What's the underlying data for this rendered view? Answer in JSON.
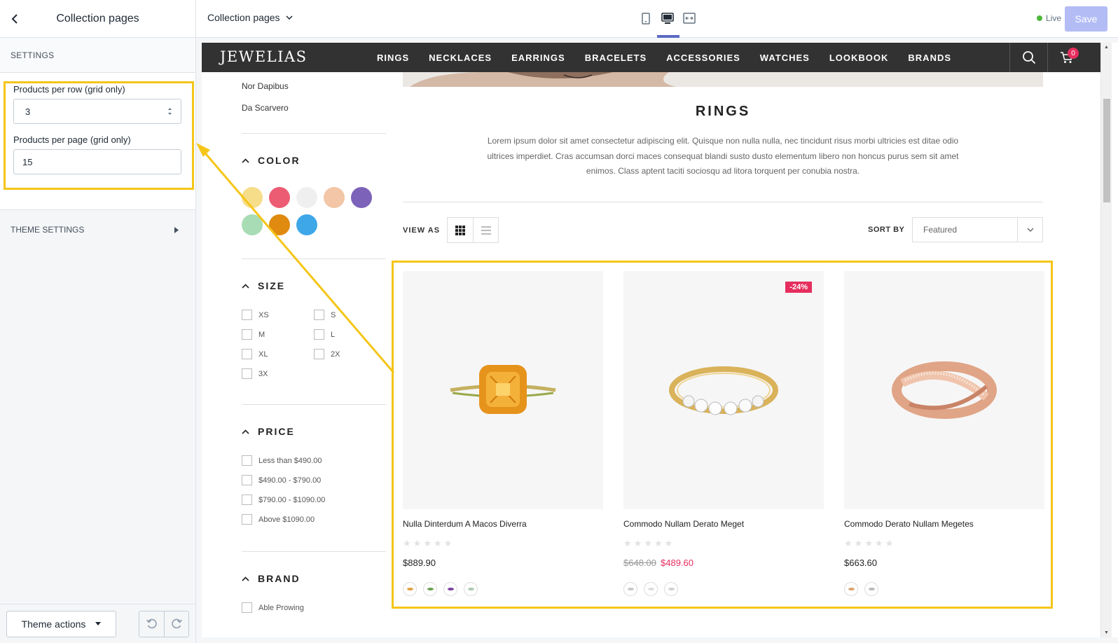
{
  "sidebar": {
    "title": "Collection pages",
    "section_label": "SETTINGS",
    "products_per_row_label": "Products per row (grid only)",
    "products_per_row_value": "3",
    "products_per_page_label": "Products per page (grid only)",
    "products_per_page_value": "15",
    "theme_settings_label": "THEME SETTINGS",
    "theme_actions_label": "Theme actions"
  },
  "topbar": {
    "page_select": "Collection pages",
    "live_label": "Live",
    "save_label": "Save",
    "active_device": "desktop"
  },
  "store": {
    "logo": "JEWELIAS",
    "menu": [
      "RINGS",
      "NECKLACES",
      "EARRINGS",
      "BRACELETS",
      "ACCESSORIES",
      "WATCHES",
      "LOOKBOOK",
      "BRANDS"
    ],
    "cart_count": "0"
  },
  "filters": {
    "vendors": [
      "Nor Dapibus",
      "Da Scarvero"
    ],
    "color_title": "COLOR",
    "colors": [
      "#f6dd8a",
      "#ec5c73",
      "#efefef",
      "#f2c6a6",
      "#7d62b9",
      "#a8dcb4",
      "#e08a10",
      "#3ea7e8"
    ],
    "size_title": "SIZE",
    "sizes": [
      "XS",
      "S",
      "M",
      "L",
      "XL",
      "2X",
      "3X"
    ],
    "price_title": "PRICE",
    "prices": [
      "Less than $490.00",
      "$490.00 - $790.00",
      "$790.00 - $1090.00",
      "Above $1090.00"
    ],
    "brand_title": "BRAND",
    "brand_first": "Able Prowing"
  },
  "collection": {
    "title": "RINGS",
    "description": "Lorem ipsum dolor sit amet consectetur adipiscing elit. Quisque non nulla nulla, nec tincidunt risus morbi ultricies est ditae odio ultrices imperdiet. Cras accumsan dorci maces consequat blandi susto dusto elementum libero non honcus purus sem sit amet enimos. Class aptent taciti sociosqu ad litora torquent per conubia nostra.",
    "view_as_label": "VIEW AS",
    "sort_label": "SORT BY",
    "sort_value": "Featured"
  },
  "products": [
    {
      "name": "Nulla Dinterdum A Macos Diverra",
      "price": "$889.90",
      "old_price": "",
      "badge": "",
      "rating": 0,
      "swatches": [
        "#e0a040",
        "#6aa050",
        "#7a3fa0",
        "#a9c9b0"
      ]
    },
    {
      "name": "Commodo Nullam Derato Meget",
      "price": "$489.60",
      "old_price": "$648.00",
      "badge": "-24%",
      "rating": 0,
      "swatches": [
        "#c8c8c8",
        "#dcdcdc",
        "#d0d0d0"
      ]
    },
    {
      "name": "Commodo Derato Nullam Megetes",
      "price": "$663.60",
      "old_price": "",
      "badge": "",
      "rating": 0,
      "swatches": [
        "#d9a070",
        "#b8b8b8"
      ]
    }
  ],
  "colors": {
    "highlight": "#f5c518",
    "sale": "#e62e5e",
    "nav_bg": "#323232",
    "save_disabled": "#b3bcf5",
    "device_active": "#5c6ac4"
  }
}
